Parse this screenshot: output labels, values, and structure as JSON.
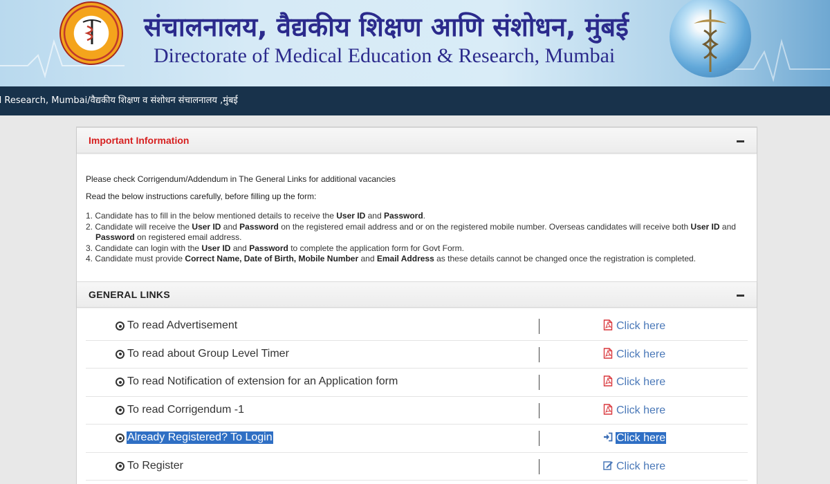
{
  "header": {
    "title_marathi": "संचालनालय, वैद्यकीय शिक्षण आणि संशोधन, मुंबई",
    "title_english": "Directorate of Medical Education & Research, Mumbai"
  },
  "navbar": {
    "breadcrumb": "d Research, Mumbai/वैद्यकीय शिक्षण व संशोधन संचालनालय ,मुंबई"
  },
  "important_info": {
    "title": "Important Information",
    "notice": "Please check Corrigendum/Addendum in The General Links for additional vacancies",
    "instructions_heading": "Read the below instructions carefully, before filling up the form:",
    "items": [
      {
        "parts": [
          "1. Candidate has to fill in the below mentioned details to receive the ",
          "User ID",
          " and ",
          "Password",
          "."
        ]
      },
      {
        "parts": [
          "2. Candidate will receive the ",
          "User ID",
          " and ",
          "Password",
          " on the registered email address and or on the registered mobile number. Overseas candidates will receive both ",
          "User ID",
          " and ",
          "Password",
          " on registered email address."
        ]
      },
      {
        "parts": [
          "3. Candidate can login with the ",
          "User ID",
          " and ",
          "Password",
          " to complete the application form for Govt Form."
        ]
      },
      {
        "parts": [
          "4. Candidate must provide ",
          "Correct Name, Date of Birth, Mobile Number",
          " and ",
          "Email Address",
          " as these details cannot be changed once the registration is completed."
        ]
      }
    ]
  },
  "general_links": {
    "title": "GENERAL LINKS",
    "rows": [
      {
        "label": "To read Advertisement",
        "action": "Click here",
        "icon": "pdf-icon",
        "highlighted": false
      },
      {
        "label": "To read about Group Level Timer",
        "action": "Click here",
        "icon": "pdf-icon",
        "highlighted": false
      },
      {
        "label": "To read Notification of extension for an Application form",
        "action": "Click here",
        "icon": "pdf-icon",
        "highlighted": false
      },
      {
        "label": "To read Corrigendum -1",
        "action": "Click here",
        "icon": "pdf-icon",
        "highlighted": false
      },
      {
        "label": "Already Registered? To Login",
        "action": "Click here",
        "icon": "sign-in-icon",
        "highlighted": true
      },
      {
        "label": "To Register",
        "action": "Click here",
        "icon": "edit-icon",
        "highlighted": false
      }
    ]
  },
  "colors": {
    "title_blue": "#2b2a8c",
    "navbar": "#18324b",
    "important_red": "#d62020",
    "link_blue": "#4a78b8",
    "pdf_red": "#d9373c",
    "selection": "#2f6fc4"
  }
}
